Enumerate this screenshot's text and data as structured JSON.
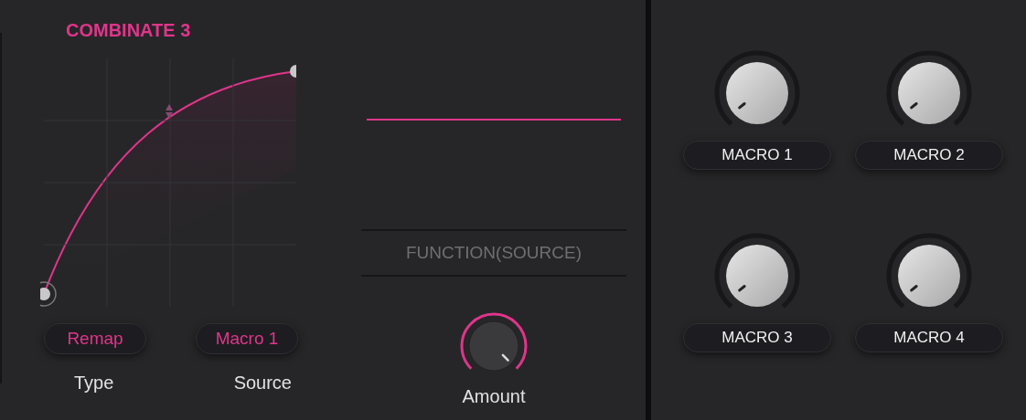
{
  "module": {
    "title": "COMBINATE 3"
  },
  "type_selector": {
    "value": "Remap",
    "label": "Type"
  },
  "source_selector": {
    "value": "Macro 1",
    "label": "Source"
  },
  "function_display": {
    "text": "FUNCTION(SOURCE)"
  },
  "amount": {
    "label": "Amount"
  },
  "macros": [
    {
      "label": "MACRO 1"
    },
    {
      "label": "MACRO 2"
    },
    {
      "label": "MACRO 3"
    },
    {
      "label": "MACRO 4"
    }
  ]
}
